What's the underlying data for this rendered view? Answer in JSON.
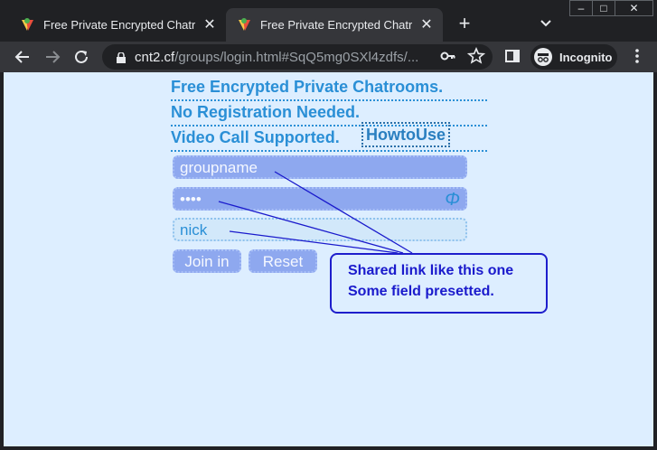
{
  "tabs": [
    {
      "title": "Free Private Encrypted Chatroo",
      "active": false
    },
    {
      "title": "Free Private Encrypted Chatroo",
      "active": true
    }
  ],
  "newtab_label": "+",
  "window_controls": {
    "minimize": "–",
    "maximize": "□",
    "close": "✕"
  },
  "address_bar": {
    "host": "cnt2.cf",
    "path": "/groups/login.html#SqQ5mg0SXl4zdfs/..."
  },
  "incognito_label": "Incognito",
  "page": {
    "headline1": "Free Encrypted Private Chatrooms.",
    "headline2": "No Registration Needed.",
    "headline3": "Video Call Supported.",
    "howto_link": "HowtoUse",
    "groupname_value": "groupname",
    "password_value": "••••",
    "password_toggle": "Φ",
    "nick_value": "nick",
    "join_button": "Join in",
    "reset_button": "Reset",
    "callout_line1": "Shared link like this one",
    "callout_line2": "Some field presetted."
  },
  "colors": {
    "page_bg": "#ddeeff",
    "headline": "#2a8fd6",
    "field_fill": "#8ea8ef",
    "callout": "#1a1acc"
  }
}
